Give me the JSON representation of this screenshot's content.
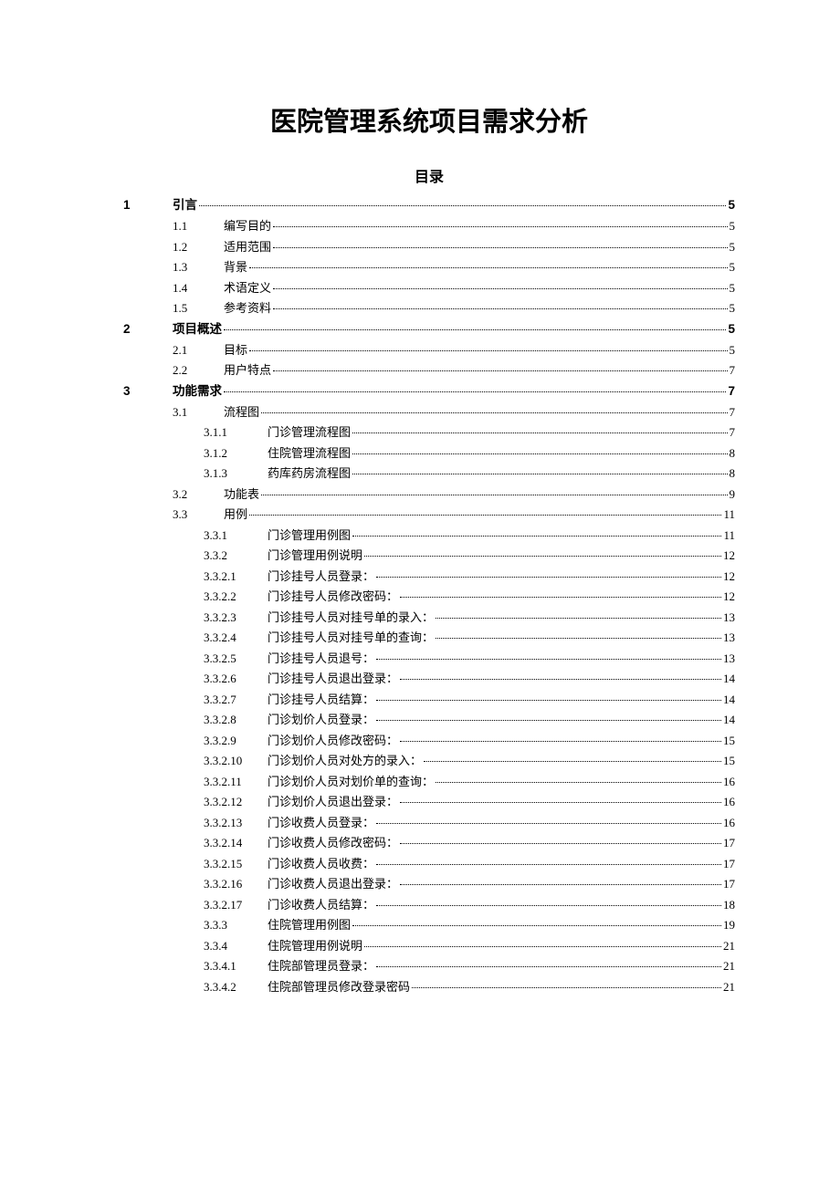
{
  "title": "医院管理系统项目需求分析",
  "subtitle": "目录",
  "toc": [
    {
      "level": 1,
      "num": "1",
      "text": "引言",
      "page": "5"
    },
    {
      "level": 2,
      "num": "1.1",
      "text": "编写目的",
      "page": "5"
    },
    {
      "level": 2,
      "num": "1.2",
      "text": "适用范围",
      "page": "5"
    },
    {
      "level": 2,
      "num": "1.3",
      "text": "背景",
      "page": "5"
    },
    {
      "level": 2,
      "num": "1.4",
      "text": "术语定义",
      "page": "5"
    },
    {
      "level": 2,
      "num": "1.5",
      "text": "参考资料",
      "page": "5"
    },
    {
      "level": 1,
      "num": "2",
      "text": "项目概述",
      "page": "5"
    },
    {
      "level": 2,
      "num": "2.1",
      "text": "目标",
      "page": "5"
    },
    {
      "level": 2,
      "num": "2.2",
      "text": "用户特点",
      "page": "7"
    },
    {
      "level": 1,
      "num": "3",
      "text": "功能需求",
      "page": "7"
    },
    {
      "level": 2,
      "num": "3.1",
      "text": "流程图",
      "page": "7"
    },
    {
      "level": 3,
      "num": "3.1.1",
      "text": "门诊管理流程图",
      "page": "7"
    },
    {
      "level": 3,
      "num": "3.1.2",
      "text": "住院管理流程图",
      "page": "8"
    },
    {
      "level": 3,
      "num": "3.1.3",
      "text": "药库药房流程图",
      "page": "8"
    },
    {
      "level": 2,
      "num": "3.2",
      "text": "功能表",
      "page": "9"
    },
    {
      "level": 2,
      "num": "3.3",
      "text": "用例",
      "page": "11"
    },
    {
      "level": 3,
      "num": "3.3.1",
      "text": "门诊管理用例图",
      "page": "11"
    },
    {
      "level": 3,
      "num": "3.3.2",
      "text": "门诊管理用例说明",
      "page": "12"
    },
    {
      "level": 3,
      "num": "3.3.2.1",
      "text": "门诊挂号人员登录：",
      "page": "12"
    },
    {
      "level": 3,
      "num": "3.3.2.2",
      "text": "门诊挂号人员修改密码：",
      "page": "12"
    },
    {
      "level": 3,
      "num": "3.3.2.3",
      "text": "门诊挂号人员对挂号单的录入：",
      "page": "13"
    },
    {
      "level": 3,
      "num": "3.3.2.4",
      "text": "门诊挂号人员对挂号单的查询：",
      "page": "13"
    },
    {
      "level": 3,
      "num": "3.3.2.5",
      "text": "门诊挂号人员退号：",
      "page": "13"
    },
    {
      "level": 3,
      "num": "3.3.2.6",
      "text": "门诊挂号人员退出登录：",
      "page": "14"
    },
    {
      "level": 3,
      "num": "3.3.2.7",
      "text": "门诊挂号人员结算：",
      "page": "14"
    },
    {
      "level": 3,
      "num": "3.3.2.8",
      "text": "门诊划价人员登录：",
      "page": "14"
    },
    {
      "level": 3,
      "num": "3.3.2.9",
      "text": "门诊划价人员修改密码：",
      "page": "15"
    },
    {
      "level": 3,
      "num": "3.3.2.10",
      "text": "门诊划价人员对处方的录入：",
      "page": "15"
    },
    {
      "level": 3,
      "num": "3.3.2.11",
      "text": "门诊划价人员对划价单的查询：",
      "page": "16"
    },
    {
      "level": 3,
      "num": "3.3.2.12",
      "text": "门诊划价人员退出登录：",
      "page": "16"
    },
    {
      "level": 3,
      "num": "3.3.2.13",
      "text": "门诊收费人员登录：",
      "page": "16"
    },
    {
      "level": 3,
      "num": "3.3.2.14",
      "text": "门诊收费人员修改密码：",
      "page": "17"
    },
    {
      "level": 3,
      "num": "3.3.2.15",
      "text": "门诊收费人员收费：",
      "page": "17"
    },
    {
      "level": 3,
      "num": "3.3.2.16",
      "text": "门诊收费人员退出登录：",
      "page": "17"
    },
    {
      "level": 3,
      "num": "3.3.2.17",
      "text": "门诊收费人员结算：",
      "page": "18"
    },
    {
      "level": 3,
      "num": "3.3.3",
      "text": "住院管理用例图",
      "page": "19"
    },
    {
      "level": 3,
      "num": "3.3.4",
      "text": "住院管理用例说明",
      "page": "21"
    },
    {
      "level": 3,
      "num": "3.3.4.1",
      "text": "住院部管理员登录：",
      "page": "21"
    },
    {
      "level": 3,
      "num": "3.3.4.2",
      "text": "住院部管理员修改登录密码",
      "page": "21"
    }
  ]
}
